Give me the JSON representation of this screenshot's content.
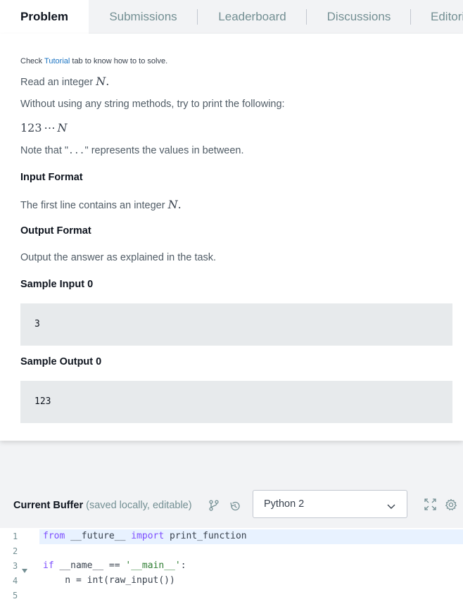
{
  "tabs": [
    {
      "label": "Problem",
      "active": true
    },
    {
      "label": "Submissions",
      "active": false
    },
    {
      "label": "Leaderboard",
      "active": false
    },
    {
      "label": "Discussions",
      "active": false
    },
    {
      "label": "Editorial",
      "active": false
    }
  ],
  "problem": {
    "hint_prefix": "Check ",
    "hint_link": "Tutorial",
    "hint_suffix": " tab to know how to to solve.",
    "read_text": "Read an integer ",
    "read_var": "N",
    "read_end": ".",
    "task_text": "Without using any string methods, try to print the following:",
    "sequence_digits": "123",
    "sequence_dots": "⋯",
    "sequence_var": "N",
    "note_prefix": "Note that \"",
    "note_code": "...",
    "note_suffix": "\" represents the values in between.",
    "input_format_heading": "Input Format",
    "input_format_text": "The first line contains an integer ",
    "input_format_var": "N",
    "input_format_end": ".",
    "output_format_heading": "Output Format",
    "output_format_text": "Output the answer as explained in the task.",
    "sample_input_heading": "Sample Input 0",
    "sample_input_value": "3",
    "sample_output_heading": "Sample Output 0",
    "sample_output_value": "123"
  },
  "editor": {
    "title": "Current Buffer",
    "note": "(saved locally, editable)",
    "language": "Python 2",
    "icons": [
      "branch-icon",
      "history-icon",
      "fullscreen-icon",
      "gear-icon"
    ],
    "lines": [
      {
        "num": "1",
        "tokens": [
          {
            "t": "from",
            "c": "kw"
          },
          {
            "t": " __future__ ",
            "c": "fn"
          },
          {
            "t": "import",
            "c": "kw"
          },
          {
            "t": " print_function",
            "c": "fn"
          }
        ]
      },
      {
        "num": "2",
        "tokens": []
      },
      {
        "num": "3",
        "tokens": [
          {
            "t": "if",
            "c": "kw"
          },
          {
            "t": " __name__ == ",
            "c": "fn"
          },
          {
            "t": "'__main__'",
            "c": "str"
          },
          {
            "t": ":",
            "c": "fn"
          }
        ]
      },
      {
        "num": "4",
        "tokens": [
          {
            "t": "    n = int(raw_input())",
            "c": "fn"
          }
        ]
      },
      {
        "num": "5",
        "tokens": []
      }
    ]
  }
}
